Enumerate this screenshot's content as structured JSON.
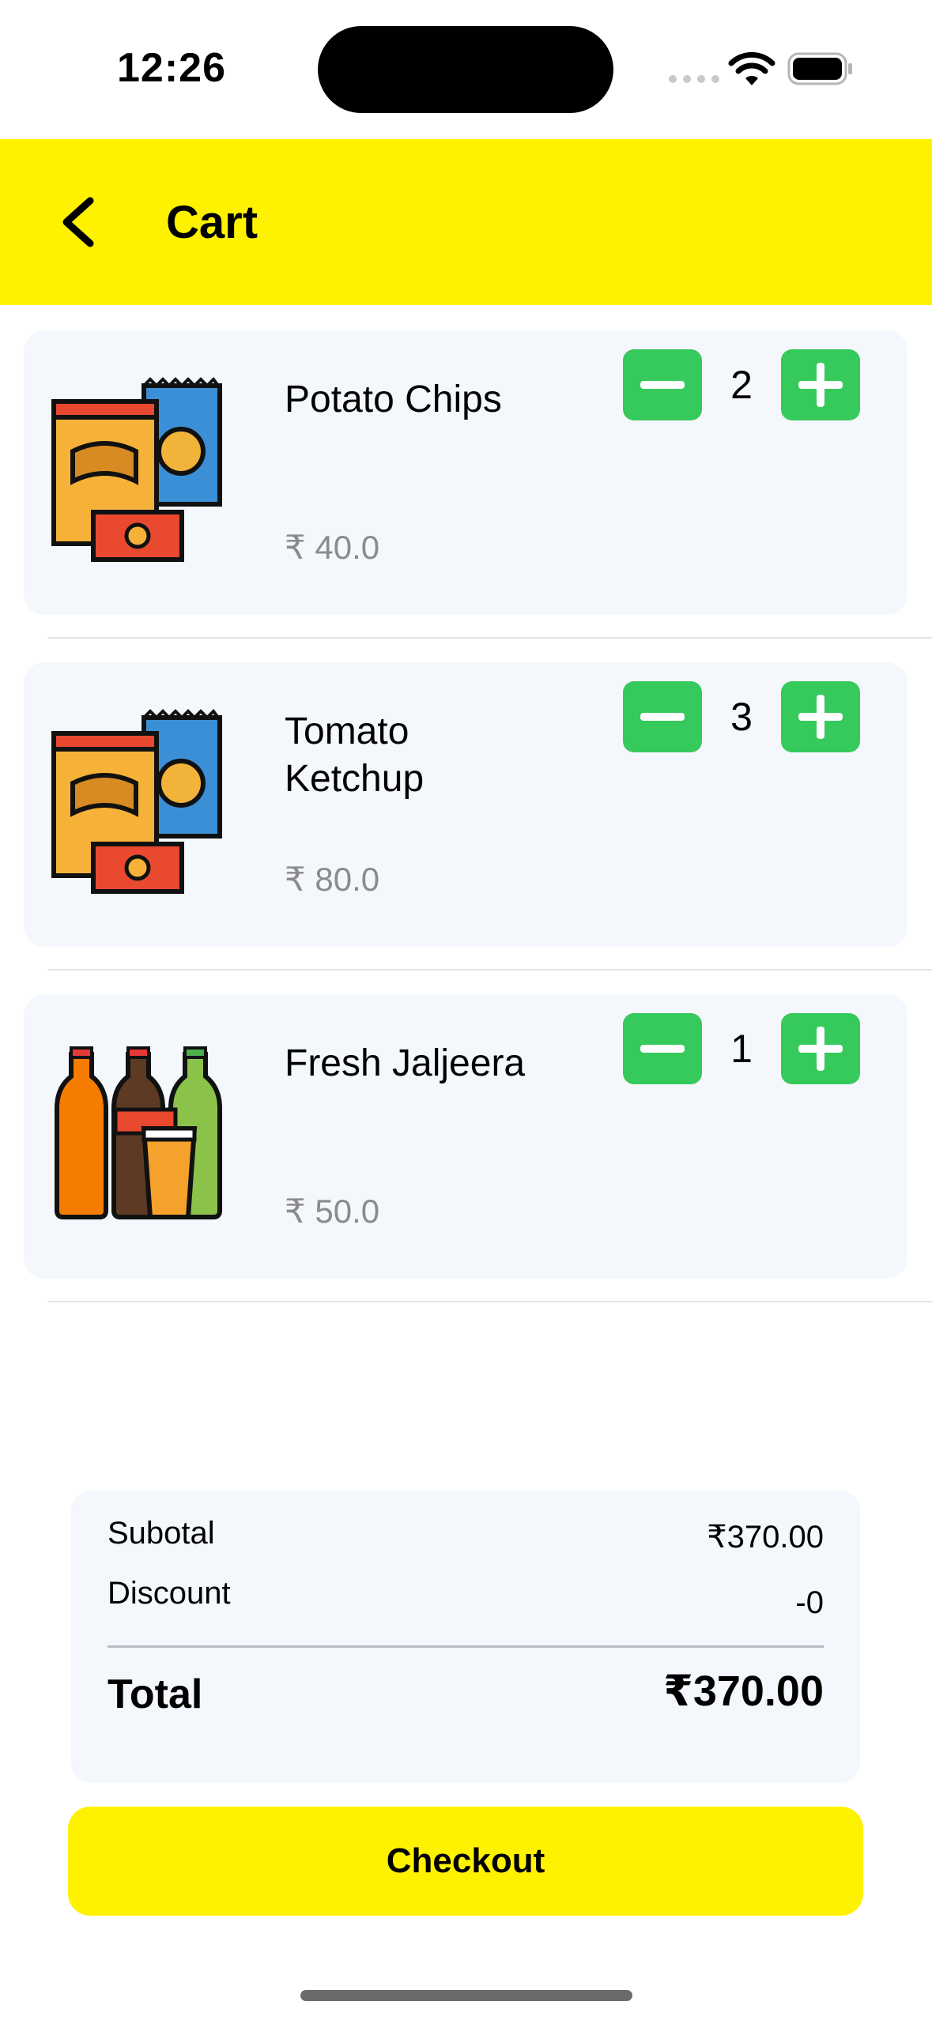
{
  "status_bar": {
    "time": "12:26"
  },
  "header": {
    "title": "Cart",
    "back_icon": "chevron-left-icon"
  },
  "items": [
    {
      "name": "Potato Chips",
      "price": "₹ 40.0",
      "quantity": "2",
      "image": "chips-icon"
    },
    {
      "name": "Tomato Ketchup",
      "price": "₹ 80.0",
      "quantity": "3",
      "image": "chips-icon"
    },
    {
      "name": "Fresh Jaljeera",
      "price": "₹ 50.0",
      "quantity": "1",
      "image": "bottles-icon"
    }
  ],
  "summary": {
    "subtotal_label": "Subotal",
    "subtotal_value": "₹370.00",
    "discount_label": "Discount",
    "discount_value": "-0",
    "total_label": "Total",
    "total_value": "₹370.00"
  },
  "checkout_label": "Checkout",
  "colors": {
    "accent": "#fff200",
    "qty_button": "#36c95b",
    "card_bg": "#f4f7fc",
    "price_text": "#8a8a8f"
  }
}
